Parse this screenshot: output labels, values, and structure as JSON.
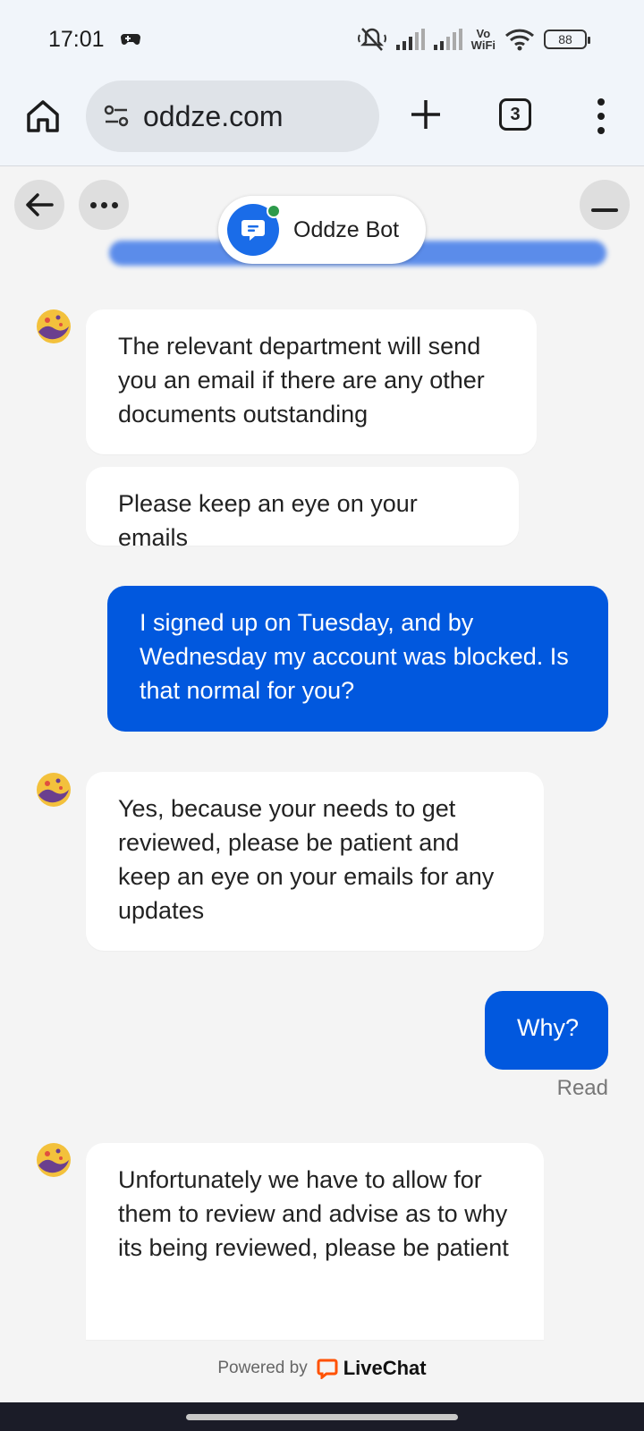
{
  "status_bar": {
    "time": "17:01",
    "vowifi_line1": "Vo",
    "vowifi_line2": "WiFi",
    "battery": "88"
  },
  "browser": {
    "url": "oddze.com",
    "tab_count": "3"
  },
  "chat": {
    "bot_name": "Oddze Bot",
    "online_color": "#2d9a4b",
    "user_bubble_color": "#0158de",
    "messages": [
      {
        "from": "agent",
        "text": "The relevant department will send you an email if there are any other documents outstanding"
      },
      {
        "from": "agent",
        "text": "Please keep an eye on your emails"
      },
      {
        "from": "user",
        "text": "I signed up on Tuesday, and by Wednesday my account was blocked. Is that normal for you?"
      },
      {
        "from": "agent",
        "text": "Yes, because your needs to get reviewed, please be patient and keep an eye on your emails for any updates"
      },
      {
        "from": "user",
        "text": "Why?"
      },
      {
        "from": "agent",
        "text": "Unfortunately we have to allow for them to review and advise as to why its being reviewed, please be patient"
      }
    ],
    "read_receipt": "Read"
  },
  "footer": {
    "powered_by": "Powered by",
    "brand": "LiveChat",
    "brand_color": "#ff5100"
  }
}
